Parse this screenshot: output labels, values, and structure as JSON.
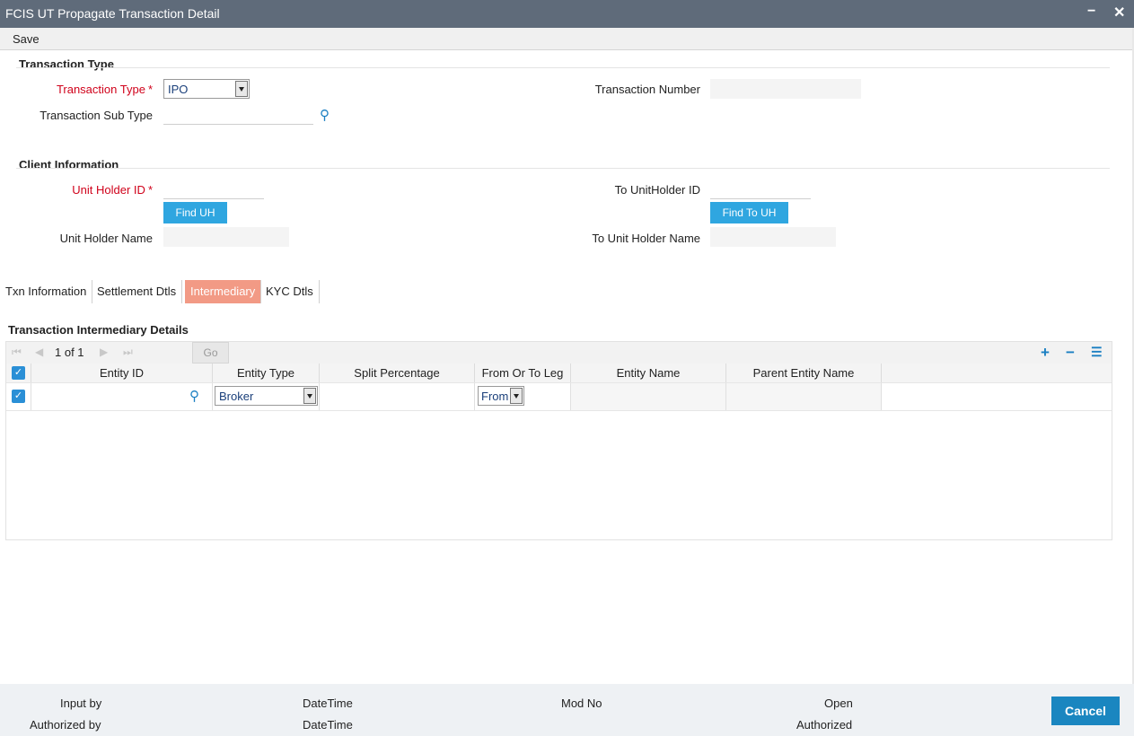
{
  "window": {
    "title": "FCIS UT Propagate Transaction Detail",
    "minimize": "−",
    "close": "✕"
  },
  "menu": {
    "save": "Save"
  },
  "transaction_type_section": {
    "title": "Transaction Type",
    "type_label": "Transaction Type",
    "type_value": "IPO",
    "sub_type_label": "Transaction Sub Type",
    "sub_type_value": "",
    "number_label": "Transaction Number",
    "number_value": ""
  },
  "client_section": {
    "title": "Client Information",
    "unit_holder_id_label": "Unit Holder ID",
    "unit_holder_id_value": "",
    "find_uh": "Find UH",
    "unit_holder_name_label": "Unit Holder Name",
    "to_unit_holder_id_label": "To UnitHolder ID",
    "find_to_uh": "Find To UH",
    "to_unit_holder_name_label": "To Unit Holder Name"
  },
  "tabs": [
    "Txn Information",
    "Settlement Dtls",
    "Intermediary",
    "KYC Dtls"
  ],
  "active_tab": "Intermediary",
  "grid": {
    "title": "Transaction Intermediary Details",
    "pager": "1 of 1",
    "go": "Go",
    "columns": [
      "Entity ID",
      "Entity Type",
      "Split Percentage",
      "From Or To Leg",
      "Entity Name",
      "Parent Entity Name"
    ],
    "rows": [
      {
        "checked": true,
        "entity_id": "",
        "entity_type": "Broker",
        "split_percentage": "",
        "leg": "From",
        "entity_name": "",
        "parent_entity_name": ""
      }
    ]
  },
  "footer": {
    "input_by": "Input by",
    "authorized_by": "Authorized by",
    "datetime1": "DateTime",
    "datetime2": "DateTime",
    "mod_no": "Mod No",
    "open": "Open",
    "authorized": "Authorized",
    "cancel": "Cancel"
  },
  "colors": {
    "titlebar": "#5f6b7a",
    "button": "#2fa6e0",
    "active_tab": "#f29a85",
    "required": "#d0021b",
    "cancel": "#1a86c0"
  }
}
